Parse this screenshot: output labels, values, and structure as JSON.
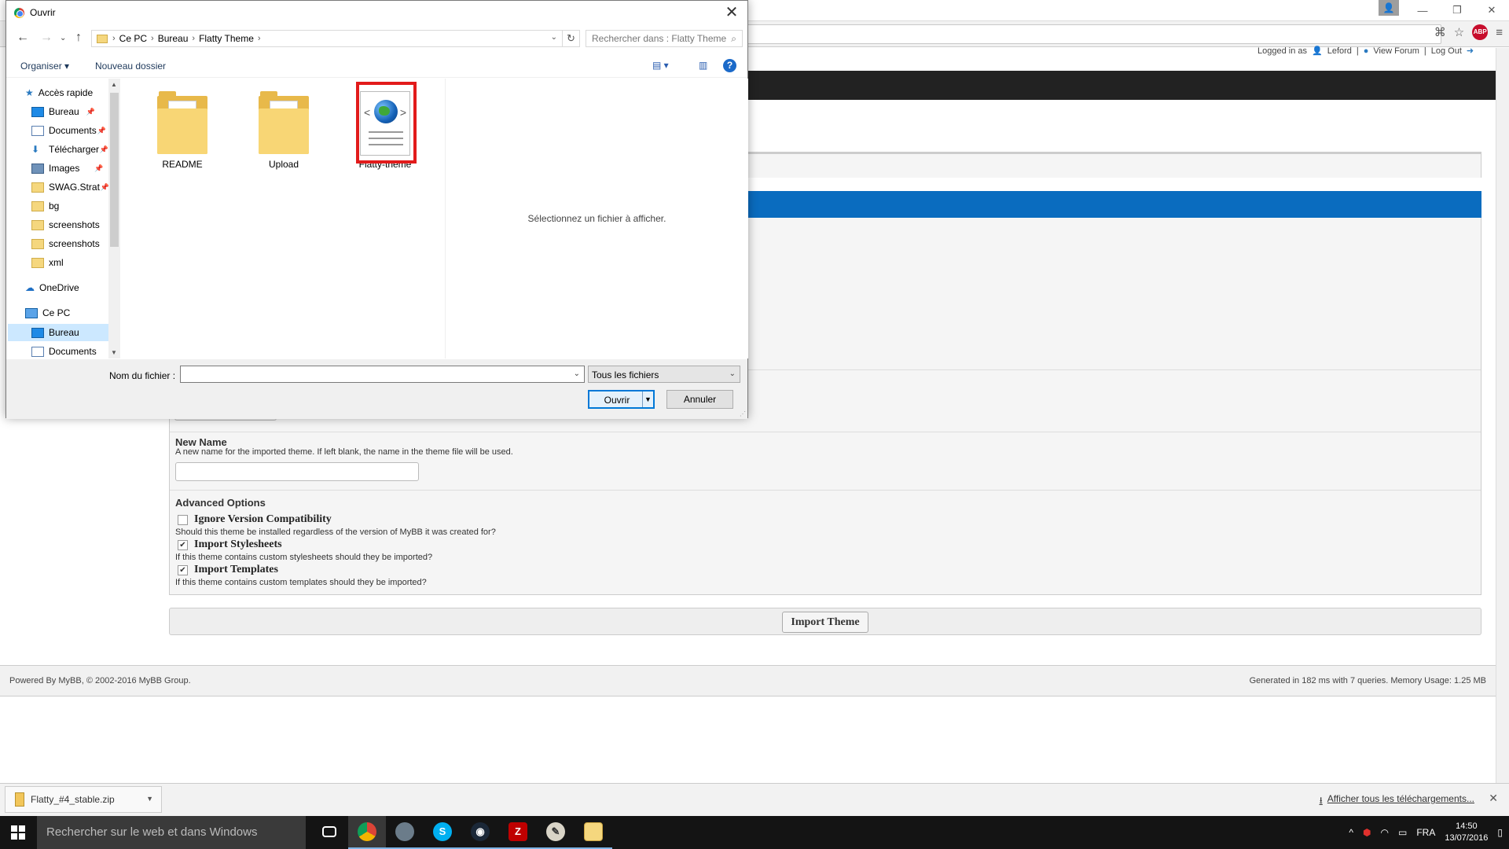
{
  "browser": {
    "user_icon": "user-icon",
    "win_minimize": "—",
    "win_restore": "❐",
    "win_close": "✕",
    "abp_label": "ABP"
  },
  "forum": {
    "logged_in_as": "Logged in as",
    "user": "Leford",
    "view_forum": "View Forum",
    "log_out": "Log Out",
    "new_name_label": "New Name",
    "new_name_desc": "A new name for the imported theme. If left blank, the name in the theme file will be used.",
    "advanced_label": "Advanced Options",
    "options": [
      {
        "label": "Ignore Version Compatibility",
        "desc": "Should this theme be installed regardless of the version of MyBB it was created for?",
        "checked": false
      },
      {
        "label": "Import Stylesheets",
        "desc": "If this theme contains custom stylesheets should they be imported?",
        "checked": true
      },
      {
        "label": "Import Templates",
        "desc": "If this theme contains custom templates should they be imported?",
        "checked": true
      }
    ],
    "import_button": "Import Theme",
    "footer_left": "Powered By MyBB, © 2002-2016 MyBB Group.",
    "footer_right": "Generated in 182 ms with 7 queries. Memory Usage: 1.25 MB",
    "accent_blue": "#0a6cbf"
  },
  "downloads": {
    "file": "Flatty_#4_stable.zip",
    "show_all": "Afficher tous les téléchargements..."
  },
  "taskbar": {
    "search_placeholder": "Rechercher sur le web et dans Windows",
    "language": "FRA",
    "time": "14:50",
    "date": "13/07/2016",
    "apps": [
      "task-view-icon",
      "chrome-icon",
      "app-icon",
      "skype-icon",
      "steam-icon",
      "filezilla-icon",
      "paint-icon",
      "explorer-icon"
    ]
  },
  "dialog": {
    "title": "Ouvrir",
    "breadcrumb": [
      "Ce PC",
      "Bureau",
      "Flatty Theme"
    ],
    "search_placeholder": "Rechercher dans : Flatty Theme",
    "organize": "Organiser",
    "new_folder": "Nouveau dossier",
    "nav_items": [
      {
        "label": "Accès rapide",
        "icon": "star-icon"
      },
      {
        "label": "Bureau",
        "icon": "desktop-icon",
        "pinned": true
      },
      {
        "label": "Documents",
        "icon": "documents-icon",
        "pinned": true
      },
      {
        "label": "Télécharger",
        "icon": "download-icon",
        "pinned": true
      },
      {
        "label": "Images",
        "icon": "images-icon",
        "pinned": true
      },
      {
        "label": "SWAG.Strat",
        "icon": "folder-icon",
        "pinned": true
      },
      {
        "label": "bg",
        "icon": "folder-icon"
      },
      {
        "label": "screenshots",
        "icon": "folder-icon"
      },
      {
        "label": "screenshots",
        "icon": "folder-icon"
      },
      {
        "label": "xml",
        "icon": "folder-icon"
      },
      {
        "label": "OneDrive",
        "icon": "cloud-icon"
      },
      {
        "label": "Ce PC",
        "icon": "computer-icon"
      },
      {
        "label": "Bureau",
        "icon": "desktop-icon",
        "selected": true
      },
      {
        "label": "Documents",
        "icon": "documents-icon"
      }
    ],
    "files": [
      {
        "name": "README",
        "type": "folder"
      },
      {
        "name": "Upload",
        "type": "folder"
      },
      {
        "name": "Flatty-theme",
        "type": "xml"
      }
    ],
    "preview_text": "Sélectionnez un fichier à afficher.",
    "filename_label": "Nom du fichier :",
    "filename_value": "",
    "filetype": "Tous les fichiers",
    "open_button": "Ouvrir",
    "cancel_button": "Annuler",
    "highlight_color": "#e21b1b"
  }
}
